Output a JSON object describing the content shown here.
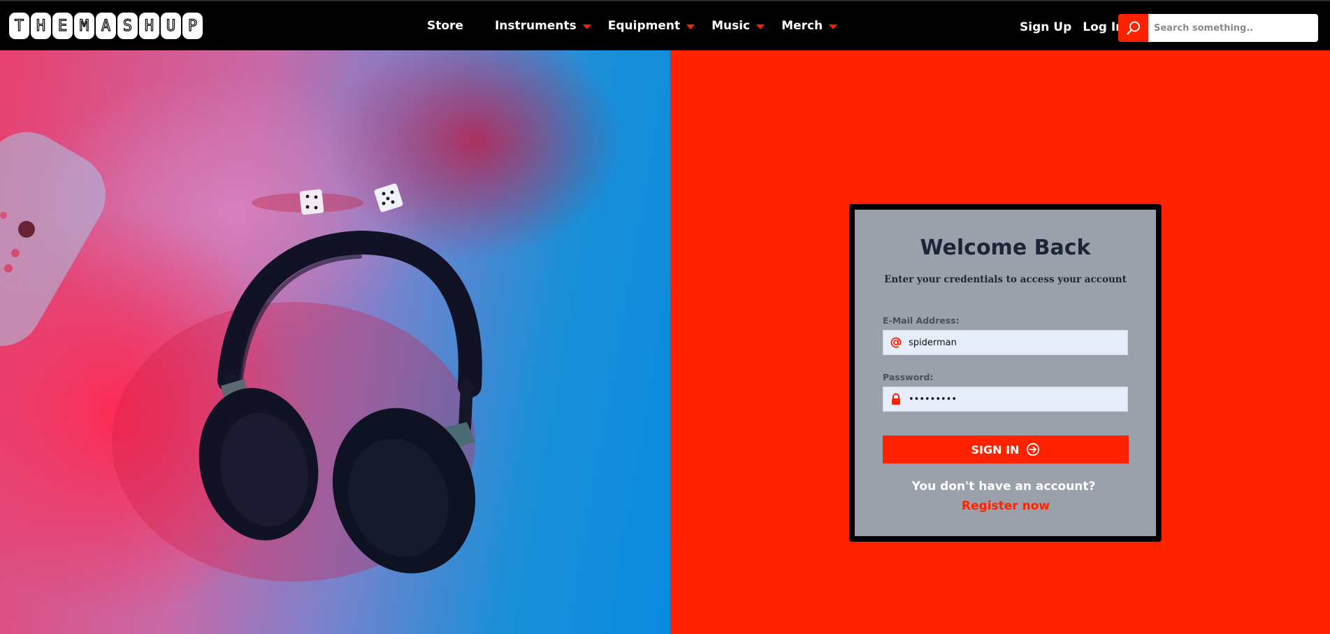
{
  "brand": {
    "logo_letters": [
      "T",
      "H",
      "E",
      "M",
      "A",
      "S",
      "H",
      "U",
      "P"
    ]
  },
  "nav": {
    "items": [
      {
        "label": "Store",
        "has_dropdown": false
      },
      {
        "label": "Instruments",
        "has_dropdown": true
      },
      {
        "label": "Equipment",
        "has_dropdown": true
      },
      {
        "label": "Music",
        "has_dropdown": true
      },
      {
        "label": "Merch",
        "has_dropdown": true
      }
    ],
    "sign_up": "Sign Up",
    "log_in": "Log In",
    "search": {
      "placeholder": "Search something..",
      "icon": "search-icon"
    }
  },
  "login": {
    "title": "Welcome Back",
    "subtitle": "Enter your credentials to access your account",
    "email": {
      "label": "E-Mail Address:",
      "value": "spiderman",
      "icon": "at-sign-icon"
    },
    "password": {
      "label": "Password:",
      "value": "123456789",
      "icon": "lock-icon"
    },
    "submit_label": "SIGN IN",
    "submit_icon": "arrow-circle-right-icon",
    "register_prompt": "You don't have an account?",
    "register_link": "Register now"
  },
  "colors": {
    "accent": "#ff2200",
    "navbar": "#000000",
    "card_bg": "#9aa1aa",
    "title": "#1c2638",
    "input_bg": "#e6edfb"
  }
}
